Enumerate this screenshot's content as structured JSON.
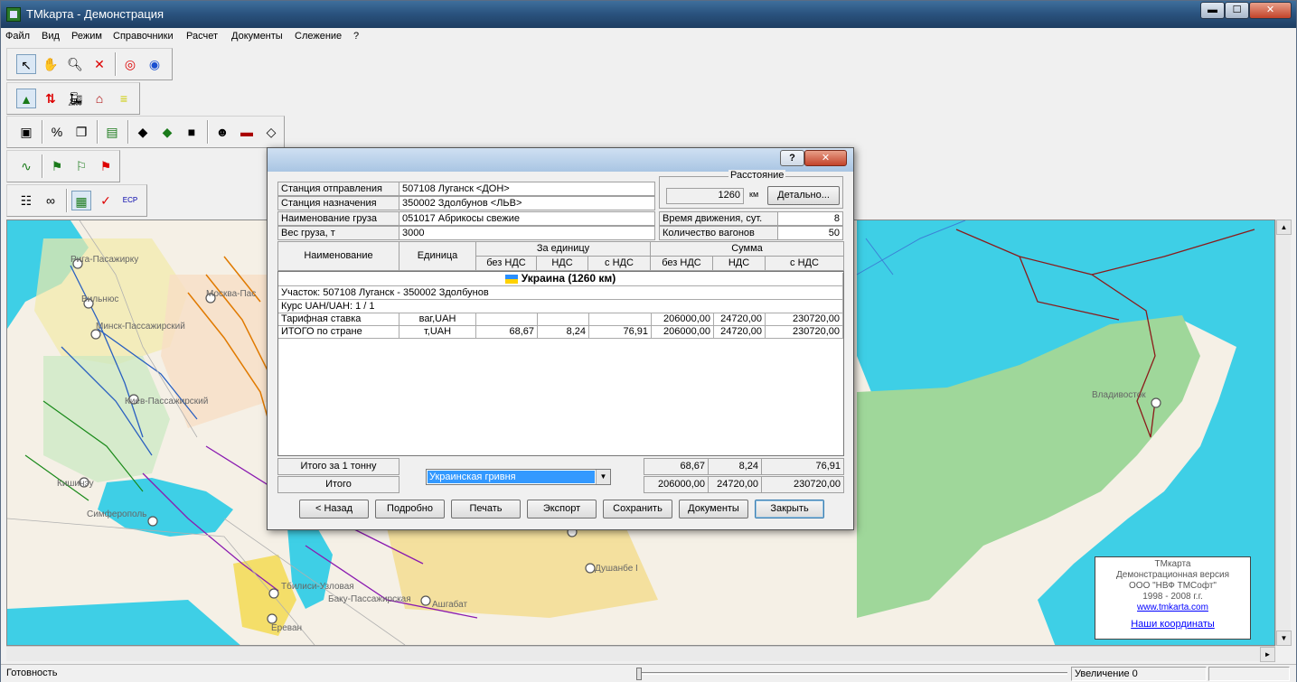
{
  "app": {
    "title": "TMkарта - Демонстрация"
  },
  "window_controls": {
    "minimize": "▬",
    "maximize": "☐",
    "close": "✕"
  },
  "menu": [
    "Файл",
    "Вид",
    "Режим",
    "Справочники",
    "Расчет",
    "Документы",
    "Слежение",
    "?"
  ],
  "toolbar_icons": [
    [
      "pointer-icon",
      "hand-icon",
      "zoom-icon",
      "delete-icon",
      "target-icon",
      "compass-icon"
    ],
    [
      "pyramid-icon",
      "exchange-icon",
      "locomotive-icon",
      "station-icon",
      "layers-icon"
    ],
    [
      "user-card-icon",
      "percent-icon",
      "copy-icon",
      "money-icon",
      "book-black-icon",
      "books-green-icon",
      "box-icon",
      "driver-icon",
      "wagon-icon",
      "tag-icon"
    ],
    [
      "route-icon",
      "flag-green-icon",
      "route-flag-icon",
      "flag-red-icon"
    ],
    [
      "properties-icon",
      "binoculars-icon",
      "map-find-icon",
      "check-route-icon",
      "ecp-route-icon"
    ]
  ],
  "map": {
    "cities": [
      {
        "name": "Рига-Пасажирку"
      },
      {
        "name": "Вильнюс"
      },
      {
        "name": "Москва-Пас"
      },
      {
        "name": "Минск-Пассажирский"
      },
      {
        "name": "Киев-Пассажирский"
      },
      {
        "name": "Кишинэу"
      },
      {
        "name": "Симферополь"
      },
      {
        "name": "Тбилиси-Узловая"
      },
      {
        "name": "Баку-Пассажирская"
      },
      {
        "name": "Ашгабат"
      },
      {
        "name": "Душанбе I"
      },
      {
        "name": "Ереван"
      },
      {
        "name": "Владивосток"
      }
    ],
    "colors": {
      "land": "#f5f0e6",
      "sea": "#3ecfe6",
      "green_zone": "#9fd79a"
    },
    "info_box": {
      "line1": "TMкарта",
      "line2": "Демонстрационная версия",
      "line3": "ООО \"НВФ ТМСофт\"",
      "line4": "1998 - 2008 г.г.",
      "link": "www.tmkarta.com",
      "coords_link": "Наши координаты"
    }
  },
  "statusbar": {
    "status": "Готовность",
    "zoom": "Увеличение 0"
  },
  "dialog": {
    "help": "?",
    "close": "✕",
    "fields": {
      "departure_label": "Станция отправления",
      "departure_value": "507108  Луганск <ДОН>",
      "destination_label": "Станция назначения",
      "destination_value": "350002  Здолбунов <ЛЬВ>",
      "cargo_label": "Наименование груза",
      "cargo_value": "051017 Абрикосы свежие",
      "weight_label": "Вес груза, т",
      "weight_value": "3000"
    },
    "distance": {
      "legend": "Расстояние",
      "value": "1260",
      "unit": "км",
      "detail_button": "Детально..."
    },
    "travel_time_label": "Время движения, сут.",
    "travel_time_value": "8",
    "wagons_label": "Количество вагонов",
    "wagons_value": "50",
    "table_header": {
      "name": "Наименование",
      "unit": "Единица",
      "per_unit": "За единицу",
      "sum": "Сумма",
      "no_vat": "без НДС",
      "vat": "НДС",
      "with_vat": "с НДС"
    },
    "country_row": "Украина (1260 км)",
    "section_row": "Участок: 507108  Луганск - 350002  Здолбунов",
    "rate_row": "Курс UAH/UAH: 1 / 1",
    "rows": [
      {
        "name": "Тарифная ставка",
        "unit": "ваг,UAH",
        "u_novat": "",
        "u_vat": "",
        "u_withvat": "",
        "s_novat": "206000,00",
        "s_vat": "24720,00",
        "s_withvat": "230720,00"
      },
      {
        "name": "ИТОГО по стране",
        "unit": "т,UAH",
        "u_novat": "68,67",
        "u_vat": "8,24",
        "u_withvat": "76,91",
        "s_novat": "206000,00",
        "s_vat": "24720,00",
        "s_withvat": "230720,00"
      }
    ],
    "totals": {
      "per_ton_label": "Итого за 1 тонну",
      "total_label": "Итого",
      "currency": "Украинская гривня",
      "per_ton_novat": "68,67",
      "per_ton_vat": "8,24",
      "per_ton_withvat": "76,91",
      "total_novat": "206000,00",
      "total_vat": "24720,00",
      "total_withvat": "230720,00"
    },
    "buttons": {
      "back": "< Назад",
      "detail": "Подробно",
      "print": "Печать",
      "export": "Экспорт",
      "save": "Сохранить",
      "documents": "Документы",
      "close": "Закрыть"
    }
  }
}
